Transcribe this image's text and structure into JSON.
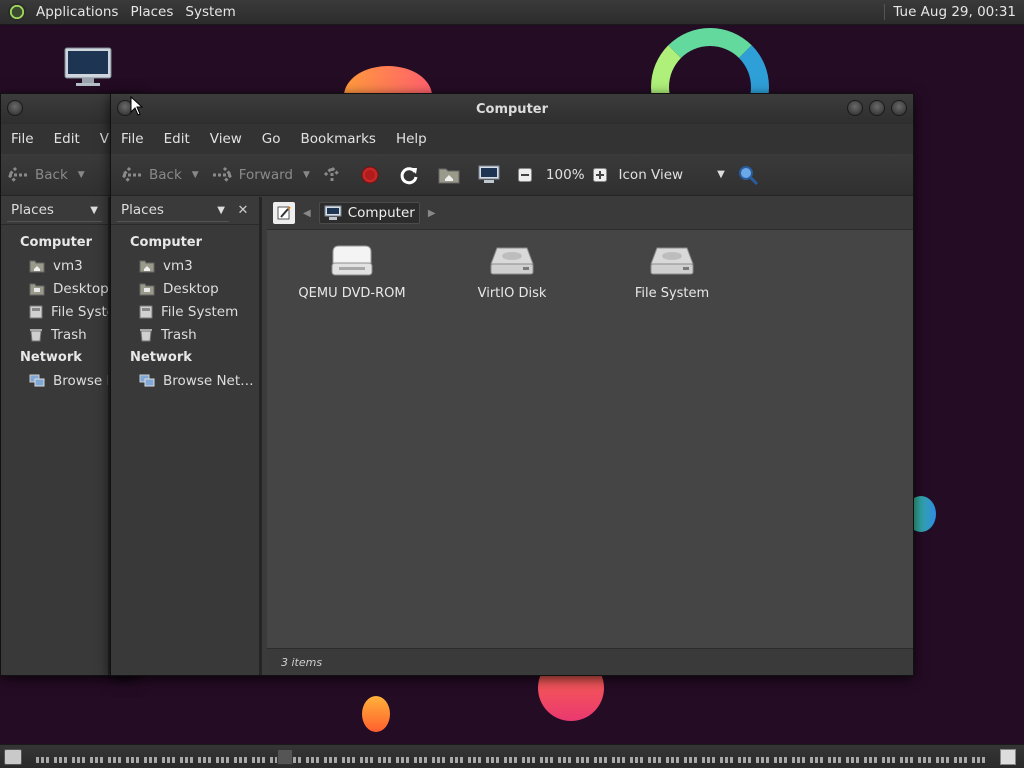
{
  "top_panel": {
    "menus": [
      "Applications",
      "Places",
      "System"
    ],
    "clock": "Tue Aug 29, 00:31"
  },
  "window": {
    "title": "Computer",
    "menubar": [
      "File",
      "Edit",
      "View",
      "Go",
      "Bookmarks",
      "Help"
    ],
    "back_menubar": [
      "File",
      "Edit",
      "View"
    ],
    "toolbar": {
      "back": "Back",
      "forward": "Forward",
      "zoom": "100%",
      "view_mode": "Icon View"
    },
    "sidebar": {
      "combo": "Places",
      "sections": [
        {
          "title": "Computer",
          "items": [
            "vm3",
            "Desktop",
            "File System",
            "Trash"
          ]
        },
        {
          "title": "Network",
          "items": [
            "Browse Network"
          ]
        }
      ],
      "truncated_items": {
        "file_system": "File System",
        "browse_network": "Browse Net…"
      }
    },
    "breadcrumb": {
      "current": "Computer"
    },
    "files": [
      {
        "name": "QEMU DVD-ROM",
        "icon": "optical-drive-icon"
      },
      {
        "name": "VirtIO Disk",
        "icon": "hard-disk-icon"
      },
      {
        "name": "File System",
        "icon": "hard-disk-icon"
      }
    ],
    "status": "3 items"
  },
  "colors": {
    "desktop_bg": "#250c25",
    "window_bg": "#3b3b3b",
    "content_bg": "#454545",
    "stop_red": "#c62828"
  }
}
